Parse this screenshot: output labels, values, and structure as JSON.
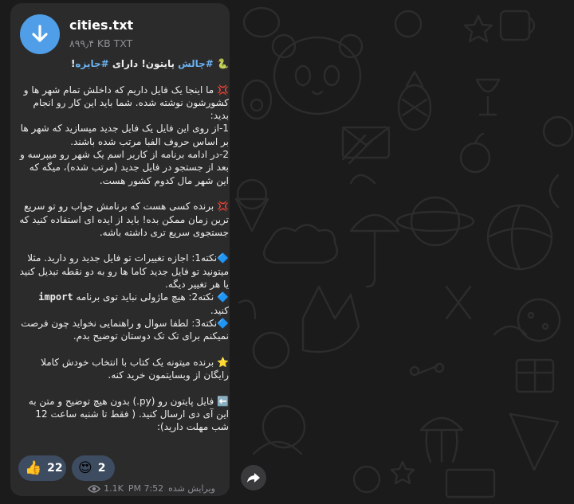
{
  "file": {
    "name": "cities.txt",
    "size": "۸۹۹٫۴ KB TXT",
    "icon": "download-icon"
  },
  "message": {
    "title_emoji": "snake-emoji",
    "title_tag1": "#چالش",
    "title_mid": " پایتون! دارای ",
    "title_tag2": "#جایزه",
    "title_end": "!",
    "p1": "ما اینجا یک فایل داریم که داخلش تمام شهر ها و کشورشون نوشته شده. شما باید این کار رو انجام بدید:\n1-از روی این فایل یک فایل جدید میسازید که شهر ها بر اساس حروف الفبا مرتب شده باشند.\n2-در ادامه برنامه از کاربر اسم یک شهر رو میپرسه و بعد از جستجو در فایل جدید (مرتب شده)، میگه که این شهر مال کدوم کشور هست.",
    "p2": "برنده کسی هست که برنامش جواب رو تو سریع ترین زمان ممکن بده! باید از ایده ای استفاده کنید که جستجوی سریع تری داشته باشه.",
    "note1": "نکته1: اجازه تغییرات تو فایل جدید رو دارید. مثلا میتونید تو فایل جدید کاما ها رو به دو نقطه تبدیل کنید یا هر تغییر دیگه.",
    "note2_a": "نکته2: هیچ ماژولی نباید توی برنامه ",
    "note2_code": "import",
    "note2_b": " کنید.",
    "note3": "نکته3: لطفا سوال و راهنمایی نخواید چون فرصت نمیکنم برای تک تک دوستان توضیح بدم.",
    "p3": "برنده میتونه یک کتاب با انتخاب خودش کاملا رایگان از وبسایتمون خرید کنه.",
    "p4": "فایل پایتون رو (py.) بدون هیچ توضیح و متن به این آی دی ارسال کنید. ( فقط تا شنبه ساعت 12 شب مهلت دارید):"
  },
  "reactions": [
    {
      "icon": "thumbs-up-emoji",
      "count": "22"
    },
    {
      "icon": "heart-eyes-emoji",
      "count": "2"
    }
  ],
  "meta": {
    "views": "1.1K",
    "time": "PM 7:52",
    "edited": "ویرایش شده",
    "views_icon": "eye-icon"
  },
  "share_icon": "share-arrow-icon",
  "colors": {
    "accent": "#4f9ee7",
    "bubble": "#2b2b2c",
    "hashtag": "#6cb2f0",
    "background": "#1b1b1b",
    "reaction_bg": "#3d4c61"
  }
}
